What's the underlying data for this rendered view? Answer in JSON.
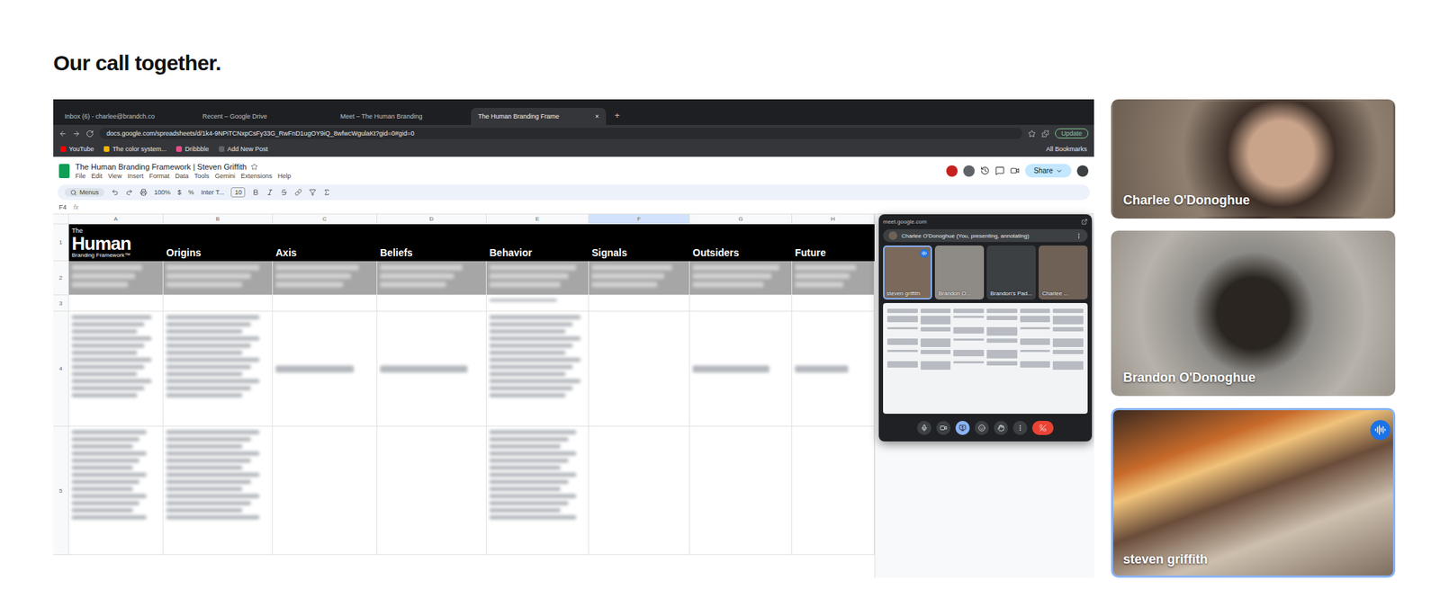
{
  "page": {
    "title": "Our call together."
  },
  "browser": {
    "tabs": [
      {
        "label": "Inbox (6) - charlee@brandch.co",
        "selected": false
      },
      {
        "label": "Recent – Google Drive",
        "selected": false
      },
      {
        "label": "Meet – The Human Branding",
        "selected": false
      },
      {
        "label": "The Human Branding Frame",
        "selected": true
      }
    ],
    "close_tab": "×",
    "new_tab": "+",
    "url": "docs.google.com/spreadsheets/d/1k4-9NPiTCNxpCsFy33G_RwFnD1ugOY9iQ_8wfwcWgulaKt?gid=0#gid=0",
    "update": "Update",
    "bookmarks": [
      "YouTube",
      "The color system...",
      "Dribbble",
      "Add New Post"
    ],
    "all_bookmarks": "All Bookmarks"
  },
  "sheet": {
    "title": "The Human Branding Framework | Steven Griffith",
    "menu": [
      "File",
      "Edit",
      "View",
      "Insert",
      "Format",
      "Data",
      "Tools",
      "Gemini",
      "Extensions",
      "Help"
    ],
    "share": "Share",
    "toolbar": {
      "search": "Menus",
      "zoom": "100%",
      "currency": "$",
      "percent": "%",
      "font": "Inter T...",
      "size": "10"
    },
    "cell_ref": "F4",
    "fx": "fx",
    "column_letters": [
      {
        "label": "A",
        "selected": false
      },
      {
        "label": "B",
        "selected": false
      },
      {
        "label": "C",
        "selected": false
      },
      {
        "label": "D",
        "selected": false
      },
      {
        "label": "E",
        "selected": false
      },
      {
        "label": "F",
        "selected": true
      },
      {
        "label": "G",
        "selected": false
      },
      {
        "label": "H",
        "selected": false
      }
    ],
    "row_numbers": [
      "1",
      "2",
      "3",
      "4",
      "5"
    ],
    "logo": {
      "top": "The",
      "main": "Human",
      "sub": "Branding Framework™"
    },
    "columns": [
      "Origins",
      "Axis",
      "Beliefs",
      "Behavior",
      "Signals",
      "Outsiders",
      "Future"
    ]
  },
  "meet_popup": {
    "url": "meet.google.com",
    "presenter": "Charlee O'Donoghue (You, presenting, annotating)",
    "tiles": [
      {
        "name": "steven griffith",
        "speaking": true
      },
      {
        "name": "Brandon O...",
        "speaking": false
      },
      {
        "name": "Brandon's Pad...",
        "speaking": false
      },
      {
        "name": "Charlee ...",
        "speaking": false
      }
    ]
  },
  "participants": [
    {
      "name": "Charlee O'Donoghue",
      "speaking": false,
      "selected": false
    },
    {
      "name": "Brandon O'Donoghue",
      "speaking": false,
      "selected": false
    },
    {
      "name": "steven griffith",
      "speaking": true,
      "selected": true
    }
  ]
}
